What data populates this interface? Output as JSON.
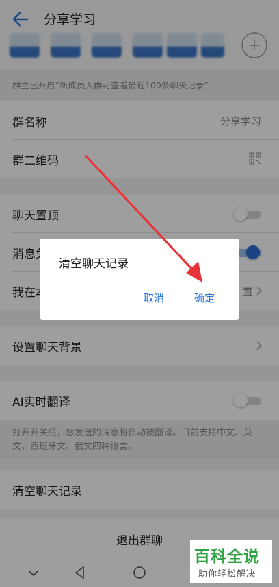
{
  "header": {
    "title": "分享学习",
    "back_icon": "back-arrow-icon"
  },
  "members": {
    "count_visible": 6,
    "add_icon": "add-member-icon"
  },
  "notice": {
    "text": "群主已开启“新成员入群可查看最近100条聊天记录”"
  },
  "settings": {
    "group_name": {
      "label": "群名称",
      "value": "分享学习"
    },
    "group_qr": {
      "label": "群二维码",
      "icon": "qr-code-icon"
    },
    "pin_chat": {
      "label": "聊天置顶",
      "enabled": false
    },
    "mute": {
      "label": "消息免打扰",
      "label_visible": "消息免",
      "enabled": true
    },
    "my_nickname": {
      "label_visible": "我在本",
      "value_visible": "置"
    },
    "chat_background": {
      "label": "设置聊天背景"
    },
    "ai_translate": {
      "label": "AI实时翻译",
      "enabled": false
    },
    "ai_hint": "打开开关后，您发送的消息将自动被翻译。目前支持中文、英文、西班牙文、俄文四种语言。",
    "clear_history": {
      "label": "清空聊天记录"
    },
    "exit_group": {
      "label": "退出群聊"
    }
  },
  "dialog": {
    "title": "清空聊天记录",
    "cancel_label": "取消",
    "confirm_label": "确定"
  },
  "navbar": {
    "icons": [
      "nav-back-icon",
      "nav-home-icon",
      "nav-recent-icon"
    ]
  },
  "watermark": {
    "title": "百科全说",
    "subtitle": "助你轻松解决"
  },
  "colors": {
    "accent": "#2b78d9",
    "toggle_on": "#2a6fd6",
    "annotation_arrow": "#e8333a",
    "watermark_green": "#2fa244"
  }
}
